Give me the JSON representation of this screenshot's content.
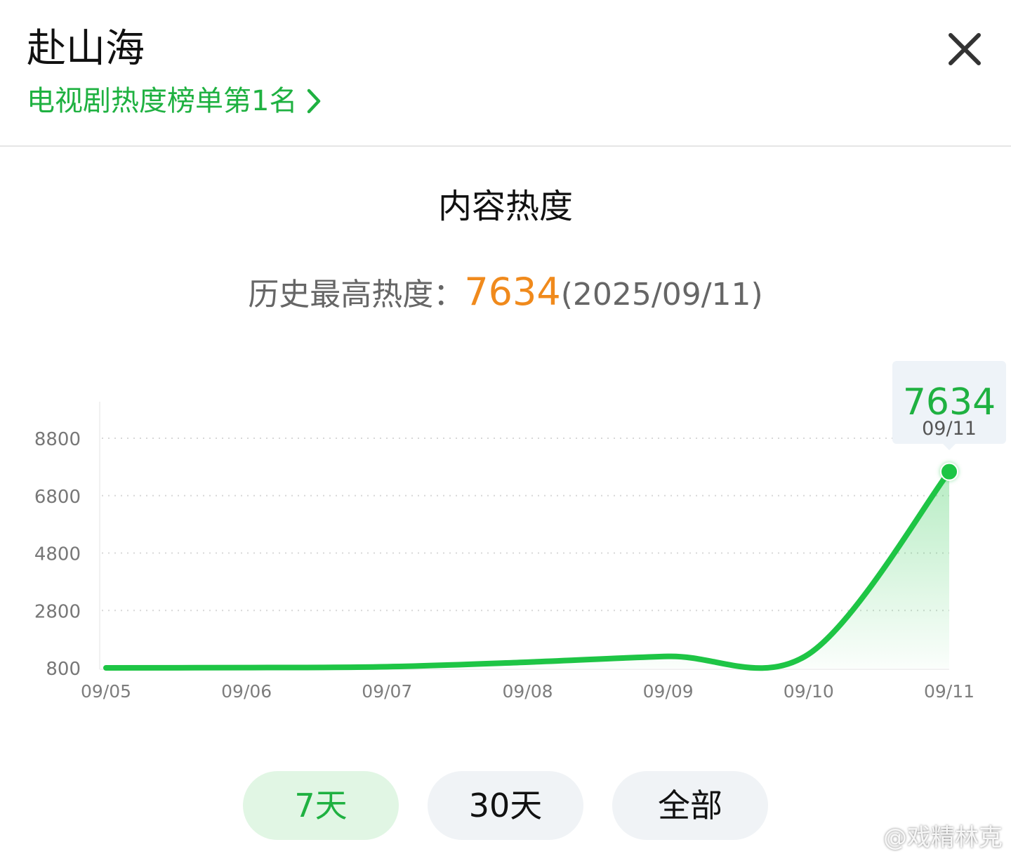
{
  "header": {
    "show_title": "赴山海",
    "rank_text": "电视剧热度榜单第1名"
  },
  "panel": {
    "title": "内容热度",
    "peak_label": "历史最高热度：",
    "peak_value": "7634",
    "peak_date": "(2025/09/11)"
  },
  "chart_data": {
    "type": "area",
    "title": "",
    "categories": [
      "09/05",
      "09/06",
      "09/07",
      "09/08",
      "09/09",
      "09/10",
      "09/11"
    ],
    "series": [
      {
        "values": [
          800,
          810,
          840,
          1000,
          1200,
          1280,
          7634
        ]
      }
    ],
    "y_ticks": [
      "800",
      "2800",
      "4800",
      "6800",
      "8800"
    ],
    "ylim": [
      800,
      8800
    ],
    "grid": "dotted horizontal",
    "tooltip": {
      "value": "7634",
      "date": "09/11"
    },
    "colors": {
      "line": "#1ec545",
      "area": "#1ec545",
      "tooltip_bg": "#eef3f8"
    }
  },
  "range_tabs": [
    {
      "label": "7天",
      "active": true
    },
    {
      "label": "30天",
      "active": false
    },
    {
      "label": "全部",
      "active": false
    }
  ],
  "watermark": "@戏精林克",
  "colors": {
    "accent": "#1fb141",
    "peak": "#f08a1c"
  }
}
